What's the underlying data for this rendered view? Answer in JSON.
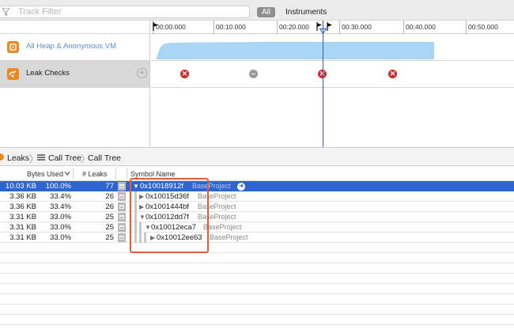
{
  "filter": {
    "placeholder": "Track Filter"
  },
  "scope_buttons": {
    "all": "All",
    "instruments": "Instruments"
  },
  "ruler": {
    "ticks": [
      "00:00.000",
      "00:10.000",
      "00:20.000",
      "00:30.000",
      "00:40.000",
      "00:50.000"
    ]
  },
  "tracks": [
    {
      "name": "All Heap & Anonymous VM",
      "icon": "allocations-icon"
    },
    {
      "name": "Leak Checks",
      "icon": "leaks-icon",
      "selected": true
    }
  ],
  "breadcrumb": {
    "root": "Leaks",
    "view": "Call Tree",
    "current": "Call Tree"
  },
  "table": {
    "headers": {
      "bytes_used": "Bytes Used",
      "leaks": "# Leaks",
      "symbol": "Symbol Name"
    },
    "rows": [
      {
        "bytes": "10.03 KB",
        "pct": "100.0%",
        "leaks": "77",
        "symbol": "0x10018912f",
        "library": "BaseProject",
        "expanded": true,
        "selected": true
      },
      {
        "bytes": "3.36 KB",
        "pct": "33.4%",
        "leaks": "26",
        "symbol": "0x10015d36f",
        "library": "BaseProject",
        "expanded": false
      },
      {
        "bytes": "3.36 KB",
        "pct": "33.4%",
        "leaks": "26",
        "symbol": "0x1001444bf",
        "library": "BaseProject",
        "expanded": false
      },
      {
        "bytes": "3.31 KB",
        "pct": "33.0%",
        "leaks": "25",
        "symbol": "0x10012dd7f",
        "library": "BaseProject",
        "expanded": true
      },
      {
        "bytes": "3.31 KB",
        "pct": "33.0%",
        "leaks": "25",
        "symbol": "0x10012eca7",
        "library": "BaseProject",
        "expanded": true
      },
      {
        "bytes": "3.31 KB",
        "pct": "33.0%",
        "leaks": "25",
        "symbol": "0x10012ee63",
        "library": "BaseProject",
        "expanded": false
      }
    ]
  },
  "colors": {
    "selection": "#2f65cf",
    "leak_marker": "#cf2a2a",
    "heap_graph": "#a9d6f5",
    "annotation": "#e25b3c",
    "track_icon": "#e98a22"
  }
}
